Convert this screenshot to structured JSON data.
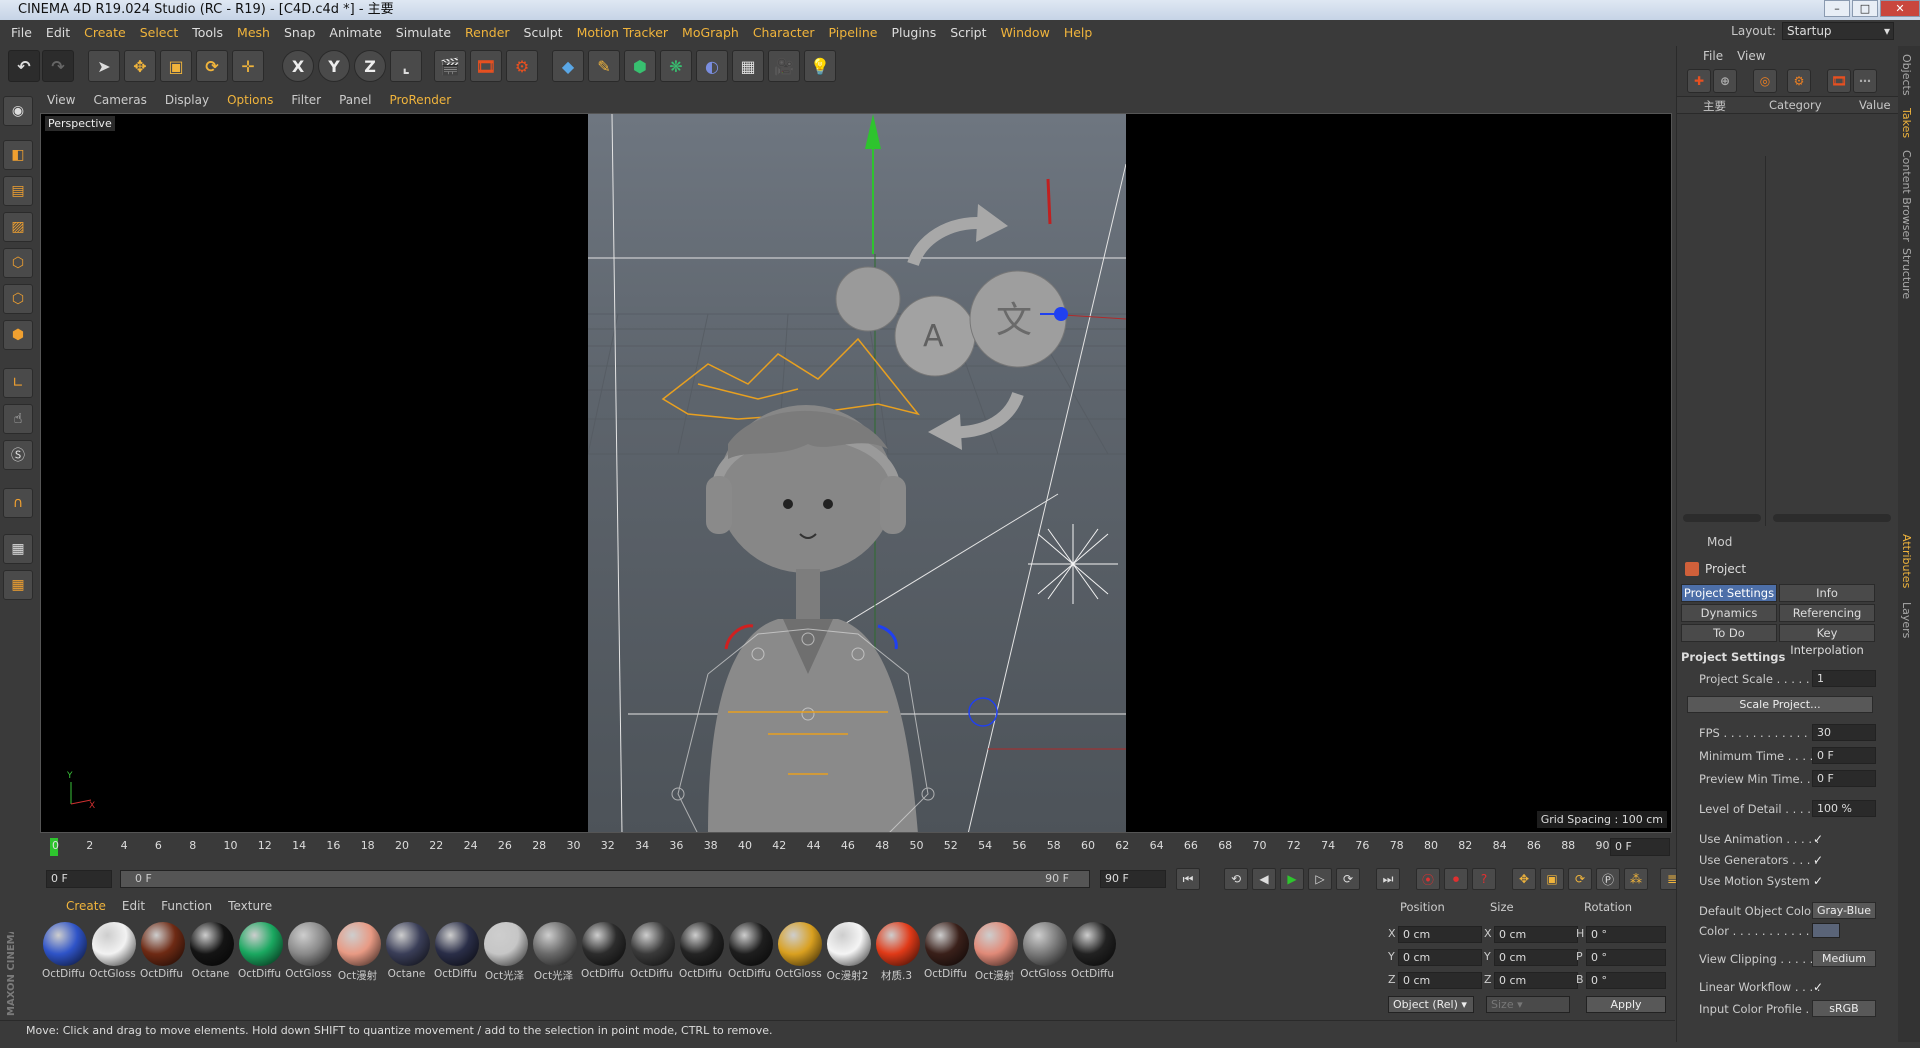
{
  "window": {
    "title": "CINEMA 4D R19.024 Studio (RC - R19) - [C4D.c4d *] - 主要",
    "min": "–",
    "max": "□",
    "close": "✕"
  },
  "menubar": {
    "items": [
      {
        "label": "File",
        "hl": false
      },
      {
        "label": "Edit",
        "hl": false
      },
      {
        "label": "Create",
        "hl": true
      },
      {
        "label": "Select",
        "hl": true
      },
      {
        "label": "Tools",
        "hl": false
      },
      {
        "label": "Mesh",
        "hl": true
      },
      {
        "label": "Snap",
        "hl": false
      },
      {
        "label": "Animate",
        "hl": false
      },
      {
        "label": "Simulate",
        "hl": false
      },
      {
        "label": "Render",
        "hl": true
      },
      {
        "label": "Sculpt",
        "hl": false
      },
      {
        "label": "Motion Tracker",
        "hl": true
      },
      {
        "label": "MoGraph",
        "hl": true
      },
      {
        "label": "Character",
        "hl": true
      },
      {
        "label": "Pipeline",
        "hl": true
      },
      {
        "label": "Plugins",
        "hl": false
      },
      {
        "label": "Script",
        "hl": false
      },
      {
        "label": "Window",
        "hl": true
      },
      {
        "label": "Help",
        "hl": true
      }
    ],
    "layout_label": "Layout:",
    "layout_value": "Startup"
  },
  "toolbar": {
    "axis_x": "X",
    "axis_y": "Y",
    "axis_z": "Z"
  },
  "viewport": {
    "menu": [
      {
        "label": "View",
        "hl": false
      },
      {
        "label": "Cameras",
        "hl": false
      },
      {
        "label": "Display",
        "hl": false
      },
      {
        "label": "Options",
        "hl": true
      },
      {
        "label": "Filter",
        "hl": false
      },
      {
        "label": "Panel",
        "hl": false
      },
      {
        "label": "ProRender",
        "hl": true
      }
    ],
    "label": "Perspective",
    "grid_spacing": "Grid Spacing : 100 cm",
    "axis_y": "Y",
    "axis_x": "X"
  },
  "timeline": {
    "ticks": [
      "0",
      "2",
      "4",
      "6",
      "8",
      "10",
      "12",
      "14",
      "16",
      "18",
      "20",
      "22",
      "24",
      "26",
      "28",
      "30",
      "32",
      "34",
      "36",
      "38",
      "40",
      "42",
      "44",
      "46",
      "48",
      "50",
      "52",
      "54",
      "56",
      "58",
      "60",
      "62",
      "64",
      "66",
      "68",
      "70",
      "72",
      "74",
      "76",
      "78",
      "80",
      "82",
      "84",
      "86",
      "88",
      "90"
    ],
    "current_frame": "0 F",
    "start": "0 F",
    "range_start": "0 F",
    "range_end": "90 F",
    "end": "90 F"
  },
  "materials": {
    "menu": [
      {
        "label": "Create",
        "hl": true
      },
      {
        "label": "Edit",
        "hl": false
      },
      {
        "label": "Function",
        "hl": false
      },
      {
        "label": "Texture",
        "hl": false
      }
    ],
    "items": [
      {
        "name": "OctDiffu",
        "color": "#2f54c8"
      },
      {
        "name": "OctGloss",
        "color": "#f2f2f2"
      },
      {
        "name": "OctDiffu",
        "color": "#6e2a14"
      },
      {
        "name": "Octane",
        "color": "#141414"
      },
      {
        "name": "OctDiffu",
        "color": "#1aa860"
      },
      {
        "name": "OctGloss",
        "color": "#8a8a8a"
      },
      {
        "name": "Oct漫射",
        "color": "#e89a84"
      },
      {
        "name": "Octane",
        "color": "#3a3e58"
      },
      {
        "name": "OctDiffu",
        "color": "#2a2e48"
      },
      {
        "name": "Oct光泽",
        "color": "#c6c6c6"
      },
      {
        "name": "Oct光泽",
        "color": "#6a6a6a"
      },
      {
        "name": "OctDiffu",
        "color": "#2c2c2c"
      },
      {
        "name": "OctDiffu",
        "color": "#3a3a3a"
      },
      {
        "name": "OctDiffu",
        "color": "#242424"
      },
      {
        "name": "OctDiffu",
        "color": "#1e1e1e"
      },
      {
        "name": "OctGloss",
        "color": "#d9a020"
      },
      {
        "name": "Oc漫射2",
        "color": "#f4f4f4"
      },
      {
        "name": "材质.3",
        "color": "#e03a18"
      },
      {
        "name": "OctDiffu",
        "color": "#3a201a"
      },
      {
        "name": "Oct漫射",
        "color": "#e08a78"
      },
      {
        "name": "OctGloss",
        "color": "#7a7a7a"
      },
      {
        "name": "OctDiffu",
        "color": "#222222"
      }
    ]
  },
  "coords": {
    "position": "Position",
    "size": "Size",
    "rotation": "Rotation",
    "rows": [
      {
        "pl": "X",
        "pv": "0 cm",
        "sl": "X",
        "sv": "0 cm",
        "rl": "H",
        "rv": "0 °"
      },
      {
        "pl": "Y",
        "pv": "0 cm",
        "sl": "Y",
        "sv": "0 cm",
        "rl": "P",
        "rv": "0 °"
      },
      {
        "pl": "Z",
        "pv": "0 cm",
        "sl": "Z",
        "sv": "0 cm",
        "rl": "B",
        "rv": "0 °"
      }
    ],
    "mode": "Object (Rel)",
    "size_mode": "Size",
    "apply": "Apply"
  },
  "objects": {
    "menu": [
      "File",
      "View"
    ],
    "col_name": "主要",
    "col_category": "Category",
    "col_value": "Value"
  },
  "attributes": {
    "mode": "Mod",
    "title": "Project",
    "tabs": [
      {
        "label": "Project Settings",
        "active": true
      },
      {
        "label": "Info",
        "active": false
      },
      {
        "label": "Dynamics",
        "active": false
      },
      {
        "label": "Referencing",
        "active": false
      },
      {
        "label": "To Do",
        "active": false
      },
      {
        "label": "Key Interpolation",
        "active": false
      }
    ],
    "section": "Project Settings",
    "project_scale": {
      "label": "Project Scale . . . . . .",
      "value": "1"
    },
    "scale_button": "Scale Project...",
    "fps": {
      "label": "FPS . . . . . . . . . . . . . .",
      "value": "30"
    },
    "min_time": {
      "label": "Minimum Time . . . . .",
      "value": "0 F"
    },
    "preview_min": {
      "label": "Preview Min Time. . .",
      "value": "0 F"
    },
    "lod": {
      "label": "Level of Detail . . . . .",
      "value": "100 %"
    },
    "use_anim": {
      "label": "Use Animation . . . . .",
      "value": "✓"
    },
    "use_gen": {
      "label": "Use Generators . . . .",
      "value": "✓"
    },
    "use_motion": {
      "label": "Use Motion System",
      "value": "✓"
    },
    "def_color": {
      "label": "Default Object Color",
      "value": "Gray-Blue"
    },
    "color": {
      "label": "Color . . . . . . . . . . .",
      "value": ""
    },
    "view_clip": {
      "label": "View Clipping . . . . .",
      "value": "Medium"
    },
    "linear": {
      "label": "Linear Workflow . . . .",
      "value": "✓"
    },
    "icp": {
      "label": "Input Color Profile . .",
      "value": "sRGB"
    }
  },
  "side_tabs": [
    "Objects",
    "Takes",
    "Content Browser",
    "Structure",
    "Attributes",
    "Layers"
  ],
  "status": "Move: Click and drag to move elements. Hold down SHIFT to quantize movement / add to the selection in point mode, CTRL to remove.",
  "brand": "MAXON CINEMA 4D"
}
